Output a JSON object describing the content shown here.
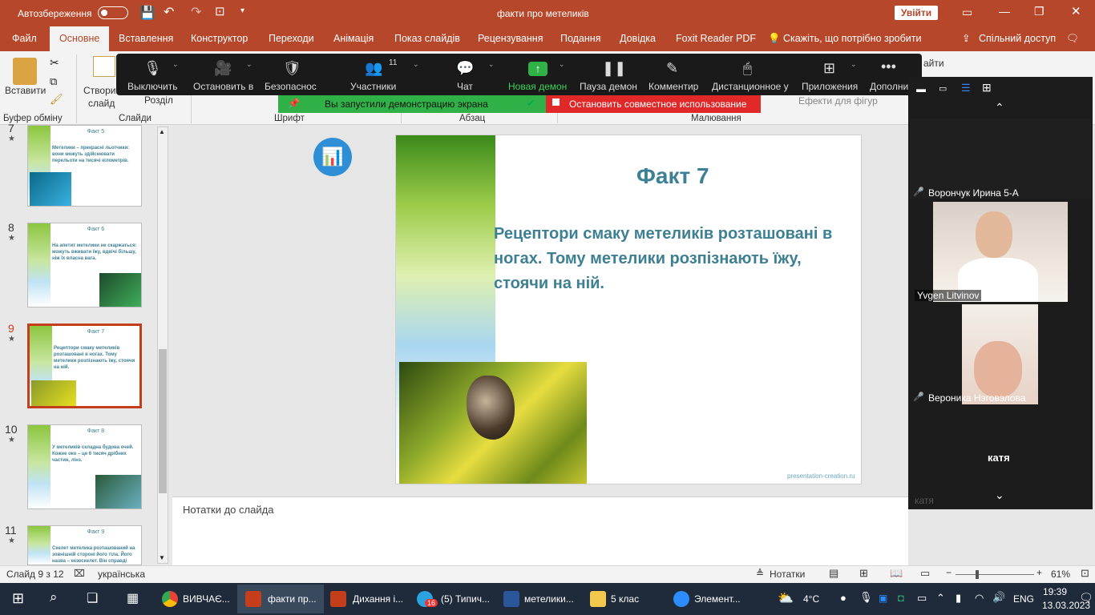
{
  "titlebar": {
    "autosave": "Автозбереження",
    "doc_title": "факти про метеликів",
    "signin": "Увійти"
  },
  "menu": {
    "items": [
      "Файл",
      "Основне",
      "Вставлення",
      "Конструктор",
      "Переходи",
      "Анімація",
      "Показ слайдів",
      "Рецензування",
      "Подання",
      "Довідка",
      "Foxit Reader PDF",
      "Скажіть, що потрібно зробити",
      "Спільний доступ"
    ]
  },
  "ribbon": {
    "paste": "Вставити",
    "create_slide": "Створити",
    "slide": "слайд",
    "section": "Розділ",
    "buffer": "Буфер обміну",
    "slides": "Слайди",
    "font": "Шрифт",
    "paragraph": "Абзац",
    "drawing": "Малювання",
    "shape_effects": "Ефекти для фігур",
    "find": "айти"
  },
  "zoom": {
    "mute": "Выключить",
    "stop_video": "Остановить в",
    "security": "Безопаснос",
    "participants": "Участники",
    "participants_count": "11",
    "chat": "Чат",
    "new_share": "Новая демон",
    "pause_share": "Пауза демон",
    "annotate": "Комментир",
    "remote": "Дистанционное у",
    "apps": "Приложения",
    "more": "Дополни"
  },
  "share_banner": {
    "text": "Вы запустили демонстрацию экрана",
    "stop": "Остановить совместное использование"
  },
  "thumbnails": [
    {
      "num": "7",
      "title": "Факт 5",
      "body": "Метелики – прекрасні льотчики: вони можуть здійснювати перельоти на тисячі кілометрів."
    },
    {
      "num": "8",
      "title": "Факт 6",
      "body": "На апетит метелики не скаржаться: можуть вживати їжу, вдвічі більшу, ніж їх власна вага."
    },
    {
      "num": "9",
      "title": "Факт 7",
      "body": "Рецептори смаку метеликів розташовані в ногах. Тому метелики розпізнають їжу, стоячи на ній."
    },
    {
      "num": "10",
      "title": "Факт 8",
      "body": "У метеликів складна будова очей. Кожне око – це 6 тисяч дрібних частин, лінз."
    },
    {
      "num": "11",
      "title": "Факт 9",
      "body": "Скелет метелика розташований на зовнішній стороні його тіла. Його назва – екзоскелет. Він справді"
    }
  ],
  "slide": {
    "title": "Факт 7",
    "body": "Рецептори смаку метеликів розташовані в ногах. Тому метелики розпізнають їжу, стоячи на ній.",
    "footer": "presentation-creation.ru"
  },
  "notes": {
    "placeholder": "Нотатки до слайда"
  },
  "participants": [
    {
      "name": "Ворончук Ирина 5-А",
      "muted": true
    },
    {
      "name": "Yvgen Litvinov",
      "muted": false
    },
    {
      "name": "Вероника Нэговэлова",
      "muted": true
    },
    {
      "name": "катя",
      "muted": false
    }
  ],
  "panel_faded": "катя",
  "status": {
    "slide": "Слайд 9 з 12",
    "lang": "українська",
    "notes": "Нотатки",
    "zoom": "61%"
  },
  "taskbar": {
    "items": [
      "ВИВЧАЄ...",
      "факти пр...",
      "Дихання і...",
      "(5) Типич...",
      "метелики...",
      "5 клас",
      "Элемент..."
    ],
    "badge": "16",
    "temp": "4°C",
    "lang": "ENG",
    "time": "19:39",
    "date": "13.03.2023"
  }
}
